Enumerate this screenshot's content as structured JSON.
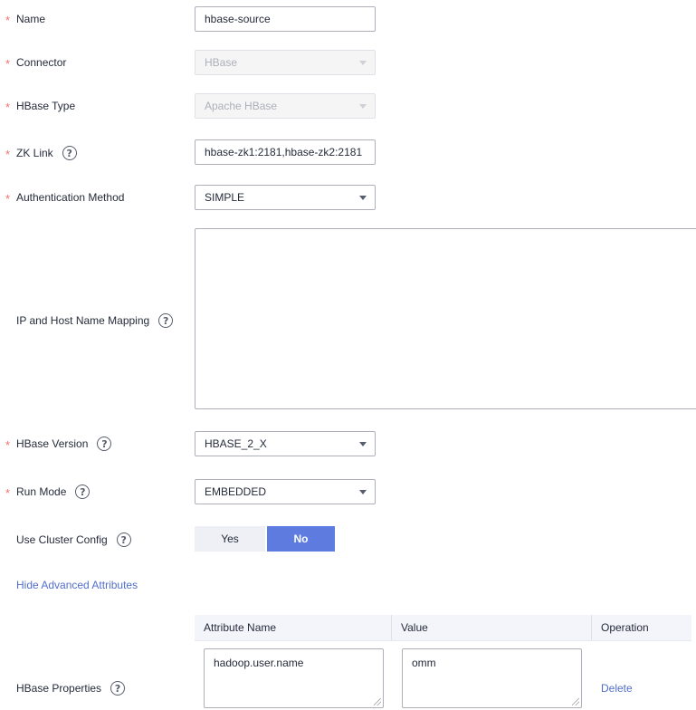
{
  "form": {
    "name": {
      "label": "Name",
      "value": "hbase-source"
    },
    "connector": {
      "label": "Connector",
      "value": "HBase"
    },
    "hbase_type": {
      "label": "HBase Type",
      "value": "Apache HBase"
    },
    "zk_link": {
      "label": "ZK Link",
      "value": "hbase-zk1:2181,hbase-zk2:2181"
    },
    "auth_method": {
      "label": "Authentication Method",
      "value": "SIMPLE"
    },
    "ip_mapping": {
      "label": "IP and Host Name Mapping",
      "value": ""
    },
    "hbase_version": {
      "label": "HBase Version",
      "value": "HBASE_2_X"
    },
    "run_mode": {
      "label": "Run Mode",
      "value": "EMBEDDED"
    },
    "use_cluster_config": {
      "label": "Use Cluster Config",
      "options": [
        "Yes",
        "No"
      ],
      "selected": "No"
    },
    "advanced_link": "Hide Advanced Attributes",
    "hbase_properties": {
      "label": "HBase Properties",
      "columns": [
        "Attribute Name",
        "Value",
        "Operation"
      ],
      "rows": [
        {
          "attribute": "hadoop.user.name",
          "value": "omm",
          "operation": "Delete"
        }
      ]
    }
  },
  "help_glyph": "?",
  "required_glyph": "*",
  "colors": {
    "required": "#f66f6a",
    "primary": "#5e7ce0",
    "link": "#526ecc"
  }
}
